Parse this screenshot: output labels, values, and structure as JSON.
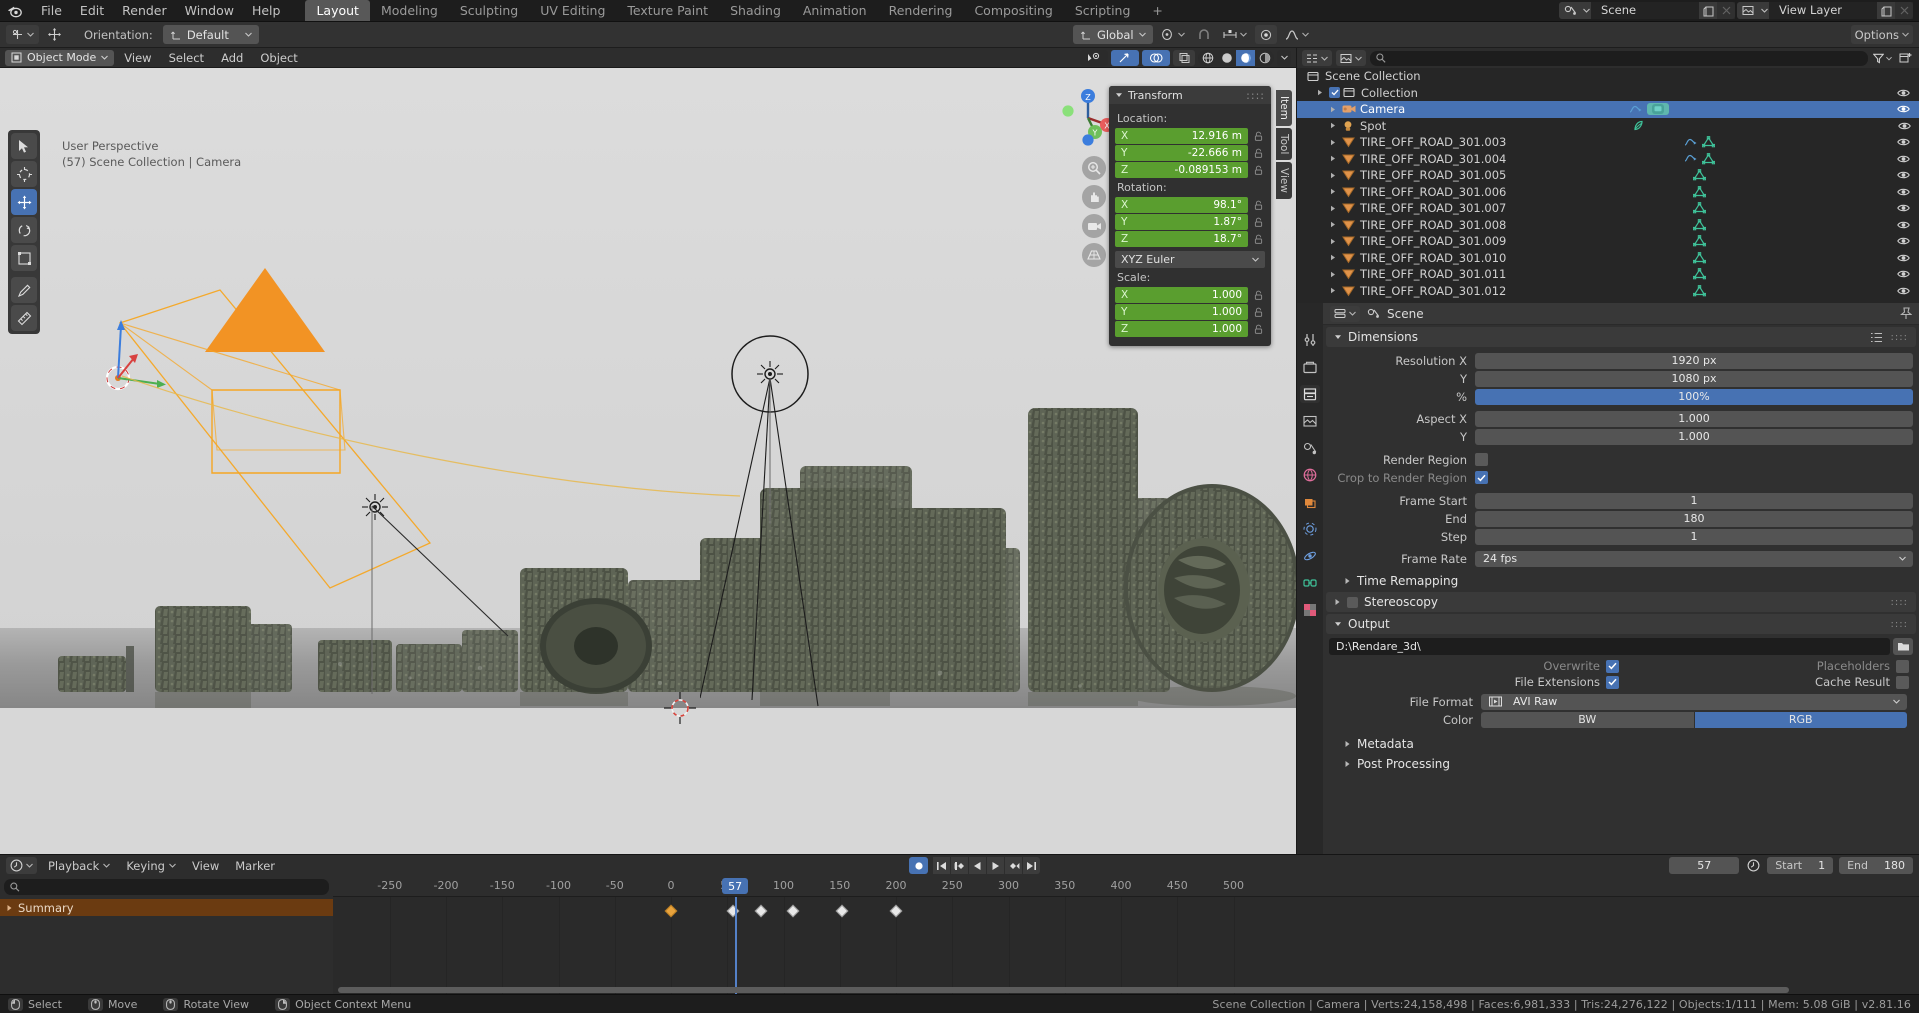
{
  "topbar": {
    "menus": [
      "File",
      "Edit",
      "Render",
      "Window",
      "Help"
    ],
    "workspaces": [
      "Layout",
      "Modeling",
      "Sculpting",
      "UV Editing",
      "Texture Paint",
      "Shading",
      "Animation",
      "Rendering",
      "Compositing",
      "Scripting"
    ],
    "active_workspace": "Layout",
    "add_workspace": "+",
    "scene_name": "Scene",
    "view_layer_name": "View Layer"
  },
  "toolheader": {
    "orientation_label": "Orientation:",
    "orientation_value": "Default",
    "transform_orientation": "Global",
    "options_label": "Options"
  },
  "viewport_header": {
    "mode": "Object Mode",
    "menus": [
      "View",
      "Select",
      "Add",
      "Object"
    ]
  },
  "viewport": {
    "perspective_text": "User Perspective",
    "scene_text": "(57) Scene Collection | Camera"
  },
  "npanel": {
    "title": "Transform",
    "tabs": [
      "Item",
      "Tool",
      "View"
    ],
    "location_label": "Location:",
    "location": [
      {
        "axis": "X",
        "value": "12.916 m"
      },
      {
        "axis": "Y",
        "value": "-22.666 m"
      },
      {
        "axis": "Z",
        "value": "-0.089153 m"
      }
    ],
    "rotation_label": "Rotation:",
    "rotation": [
      {
        "axis": "X",
        "value": "98.1°"
      },
      {
        "axis": "Y",
        "value": "1.87°"
      },
      {
        "axis": "Z",
        "value": "18.7°"
      }
    ],
    "rotation_mode": "XYZ Euler",
    "scale_label": "Scale:",
    "scale": [
      {
        "axis": "X",
        "value": "1.000"
      },
      {
        "axis": "Y",
        "value": "1.000"
      },
      {
        "axis": "Z",
        "value": "1.000"
      }
    ]
  },
  "outliner": {
    "search_placeholder": "",
    "root": "Scene Collection",
    "rows": [
      {
        "label": "Scene Collection",
        "indent": 0,
        "icon": "collection-icon",
        "selected": false,
        "checkbox": false,
        "expand": false,
        "eye": false,
        "mods": []
      },
      {
        "label": "Collection",
        "indent": 1,
        "icon": "collection-icon",
        "selected": false,
        "checkbox": true,
        "expand": true,
        "eye": true,
        "mods": []
      },
      {
        "label": "Camera",
        "indent": 2,
        "icon": "camera-icon",
        "selected": true,
        "checkbox": false,
        "expand": true,
        "eye": true,
        "mods": [
          "animation-icon",
          "camera-data-icon"
        ]
      },
      {
        "label": "Spot",
        "indent": 2,
        "icon": "light-icon",
        "selected": false,
        "checkbox": false,
        "expand": true,
        "eye": true,
        "mods": [
          "light-data-icon"
        ]
      },
      {
        "label": "TIRE_OFF_ROAD_301.003",
        "indent": 2,
        "icon": "mesh-object-icon",
        "selected": false,
        "checkbox": false,
        "expand": true,
        "eye": true,
        "mods": [
          "animation-icon",
          "mesh-data-icon"
        ]
      },
      {
        "label": "TIRE_OFF_ROAD_301.004",
        "indent": 2,
        "icon": "mesh-object-icon",
        "selected": false,
        "checkbox": false,
        "expand": true,
        "eye": true,
        "mods": [
          "animation-icon",
          "mesh-data-icon"
        ]
      },
      {
        "label": "TIRE_OFF_ROAD_301.005",
        "indent": 2,
        "icon": "mesh-object-icon",
        "selected": false,
        "checkbox": false,
        "expand": true,
        "eye": true,
        "mods": [
          "mesh-data-icon"
        ]
      },
      {
        "label": "TIRE_OFF_ROAD_301.006",
        "indent": 2,
        "icon": "mesh-object-icon",
        "selected": false,
        "checkbox": false,
        "expand": true,
        "eye": true,
        "mods": [
          "mesh-data-icon"
        ]
      },
      {
        "label": "TIRE_OFF_ROAD_301.007",
        "indent": 2,
        "icon": "mesh-object-icon",
        "selected": false,
        "checkbox": false,
        "expand": true,
        "eye": true,
        "mods": [
          "mesh-data-icon"
        ]
      },
      {
        "label": "TIRE_OFF_ROAD_301.008",
        "indent": 2,
        "icon": "mesh-object-icon",
        "selected": false,
        "checkbox": false,
        "expand": true,
        "eye": true,
        "mods": [
          "mesh-data-icon"
        ]
      },
      {
        "label": "TIRE_OFF_ROAD_301.009",
        "indent": 2,
        "icon": "mesh-object-icon",
        "selected": false,
        "checkbox": false,
        "expand": true,
        "eye": true,
        "mods": [
          "mesh-data-icon"
        ]
      },
      {
        "label": "TIRE_OFF_ROAD_301.010",
        "indent": 2,
        "icon": "mesh-object-icon",
        "selected": false,
        "checkbox": false,
        "expand": true,
        "eye": true,
        "mods": [
          "mesh-data-icon"
        ]
      },
      {
        "label": "TIRE_OFF_ROAD_301.011",
        "indent": 2,
        "icon": "mesh-object-icon",
        "selected": false,
        "checkbox": false,
        "expand": true,
        "eye": true,
        "mods": [
          "mesh-data-icon"
        ]
      },
      {
        "label": "TIRE_OFF_ROAD_301.012",
        "indent": 2,
        "icon": "mesh-object-icon",
        "selected": false,
        "checkbox": false,
        "expand": true,
        "eye": true,
        "mods": [
          "mesh-data-icon"
        ]
      }
    ]
  },
  "properties": {
    "breadcrumb": "Scene",
    "sections": {
      "dimensions": {
        "title": "Dimensions",
        "rows": [
          {
            "label": "Resolution X",
            "value": "1920 px",
            "style": "grey"
          },
          {
            "label": "Y",
            "value": "1080 px",
            "style": "grey"
          },
          {
            "label": "%",
            "value": "100%",
            "style": "blue"
          },
          {
            "label": "Aspect X",
            "value": "1.000",
            "style": "grey"
          },
          {
            "label": "Y",
            "value": "1.000",
            "style": "grey"
          }
        ],
        "render_region_label": "Render Region",
        "render_region_checked": false,
        "crop_label": "Crop to Render Region",
        "crop_checked": true,
        "frame_rows": [
          {
            "label": "Frame Start",
            "value": "1"
          },
          {
            "label": "End",
            "value": "180"
          },
          {
            "label": "Step",
            "value": "1"
          }
        ],
        "frame_rate_label": "Frame Rate",
        "frame_rate_value": "24 fps"
      },
      "time_remapping": "Time Remapping",
      "stereoscopy": "Stereoscopy",
      "output": {
        "title": "Output",
        "path": "D:\\Rendare_3d\\",
        "overwrite_label": "Overwrite",
        "overwrite_checked": true,
        "placeholders_label": "Placeholders",
        "placeholders_checked": false,
        "file_extensions_label": "File Extensions",
        "file_extensions_checked": true,
        "cache_result_label": "Cache Result",
        "cache_result_checked": false,
        "file_format_label": "File Format",
        "file_format_value": "AVI Raw",
        "color_label": "Color",
        "color_options": [
          "BW",
          "RGB"
        ],
        "color_selected": "RGB"
      },
      "metadata": "Metadata",
      "post_processing": "Post Processing"
    }
  },
  "timeline": {
    "menus": [
      "Playback",
      "Keying",
      "View",
      "Marker"
    ],
    "current_frame": "57",
    "start_label": "Start",
    "start_value": "1",
    "end_label": "End",
    "end_value": "180",
    "summary_label": "Summary",
    "search_placeholder": "",
    "ruler_ticks": [
      "-250",
      "-200",
      "-150",
      "-100",
      "-50",
      "0",
      "50",
      "100",
      "150",
      "200",
      "250",
      "300",
      "350",
      "400",
      "450",
      "500"
    ],
    "keyframes": [
      {
        "frame": 0,
        "selected": true
      },
      {
        "frame": 55,
        "selected": false
      },
      {
        "frame": 80,
        "selected": false
      },
      {
        "frame": 108,
        "selected": false
      },
      {
        "frame": 152,
        "selected": false
      },
      {
        "frame": 200,
        "selected": false
      }
    ]
  },
  "statusbar": {
    "items": [
      {
        "key": "mouse-left",
        "label": "Select"
      },
      {
        "key": "mouse-middle",
        "label": "Move"
      },
      {
        "key": "mouse-middle",
        "label": "Rotate View"
      },
      {
        "key": "mouse-right",
        "label": "Object Context Menu"
      }
    ],
    "info": "Scene Collection | Camera | Verts:24,158,498 | Faces:6,981,333 | Tris:24,276,122 | Objects:1/111 | Mem: 5.08 GiB | v2.81.16"
  },
  "colors": {
    "accent_blue": "#4772b3",
    "green_field": "#5a9e2f",
    "orange_channel": "#6b3b11",
    "bg_dark": "#1d1d1d",
    "panel_bg": "#303030"
  }
}
